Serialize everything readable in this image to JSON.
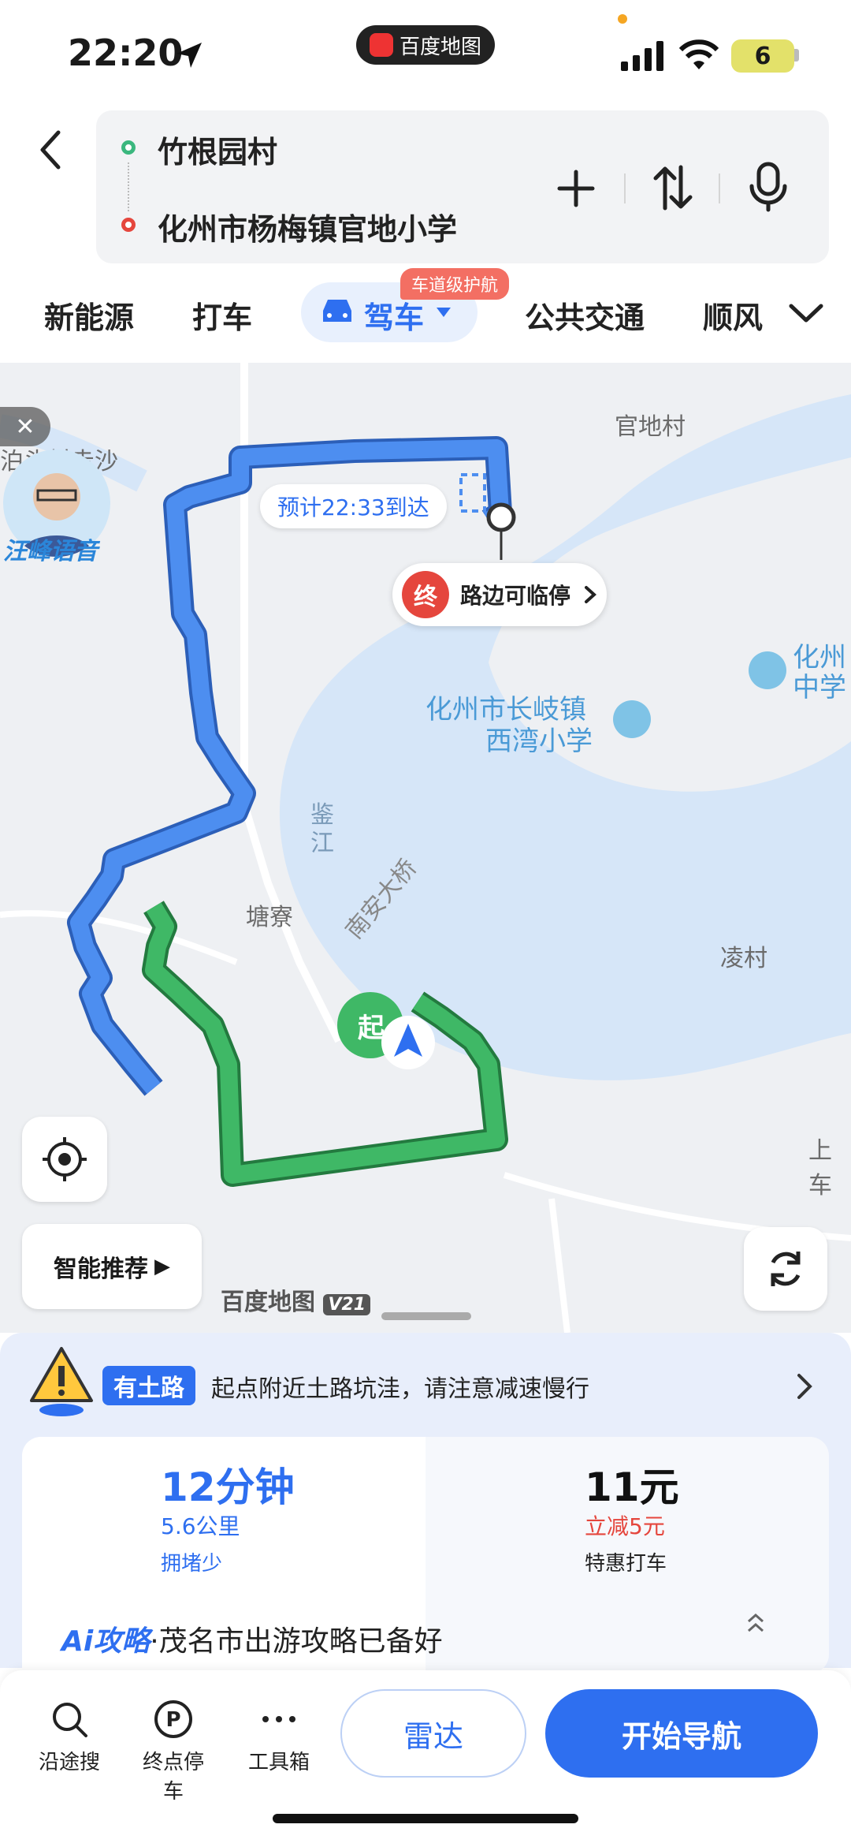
{
  "status_bar": {
    "time": "22:20",
    "app_name": "百度地图",
    "battery": "6"
  },
  "route": {
    "origin": "竹根园村",
    "destination": "化州市杨梅镇官地小学"
  },
  "modes": {
    "new_energy": "新能源",
    "taxi": "打车",
    "drive": "驾车",
    "drive_badge": "车道级护航",
    "transit": "公共交通",
    "ride": "顺风"
  },
  "map": {
    "labels": {
      "village1": "官地村",
      "village_left": "泊头村赤沙",
      "school1_line1": "化州市长岐镇",
      "school1_line2": "西湾小学",
      "school2_line1": "化州",
      "school2_line2": "中学",
      "river": "鉴江",
      "bridge": "南安大桥",
      "tangzhai": "塘寮",
      "lingcun": "凌村",
      "shangche": "上车"
    },
    "eta": "预计22:33到达",
    "end_marker": "终",
    "end_label": "路边可临停",
    "start_marker": "起",
    "voice_label": "汪峰语音",
    "recommend": "智能推荐",
    "brand": "百度地图",
    "brand_version": "V21",
    "colors": {
      "route_blue": "#4d8ef0",
      "route_green": "#3fb866",
      "water": "#d6e6f8"
    }
  },
  "notice": {
    "tag": "有土路",
    "text": "起点附近土路坑洼，请注意减速慢行"
  },
  "routes": [
    {
      "time": "12分钟",
      "distance": "5.6公里",
      "traffic": "拥堵少"
    },
    {
      "price": "11元",
      "discount": "立减5元",
      "label": "特惠打车"
    }
  ],
  "ai": {
    "tag": "Ai攻略",
    "text": "·茂名市出游攻略已备好"
  },
  "toolbar": {
    "along_search": "沿途搜",
    "dest_parking": "终点停车",
    "toolbox": "工具箱",
    "radar": "雷达",
    "start_nav": "开始导航"
  }
}
